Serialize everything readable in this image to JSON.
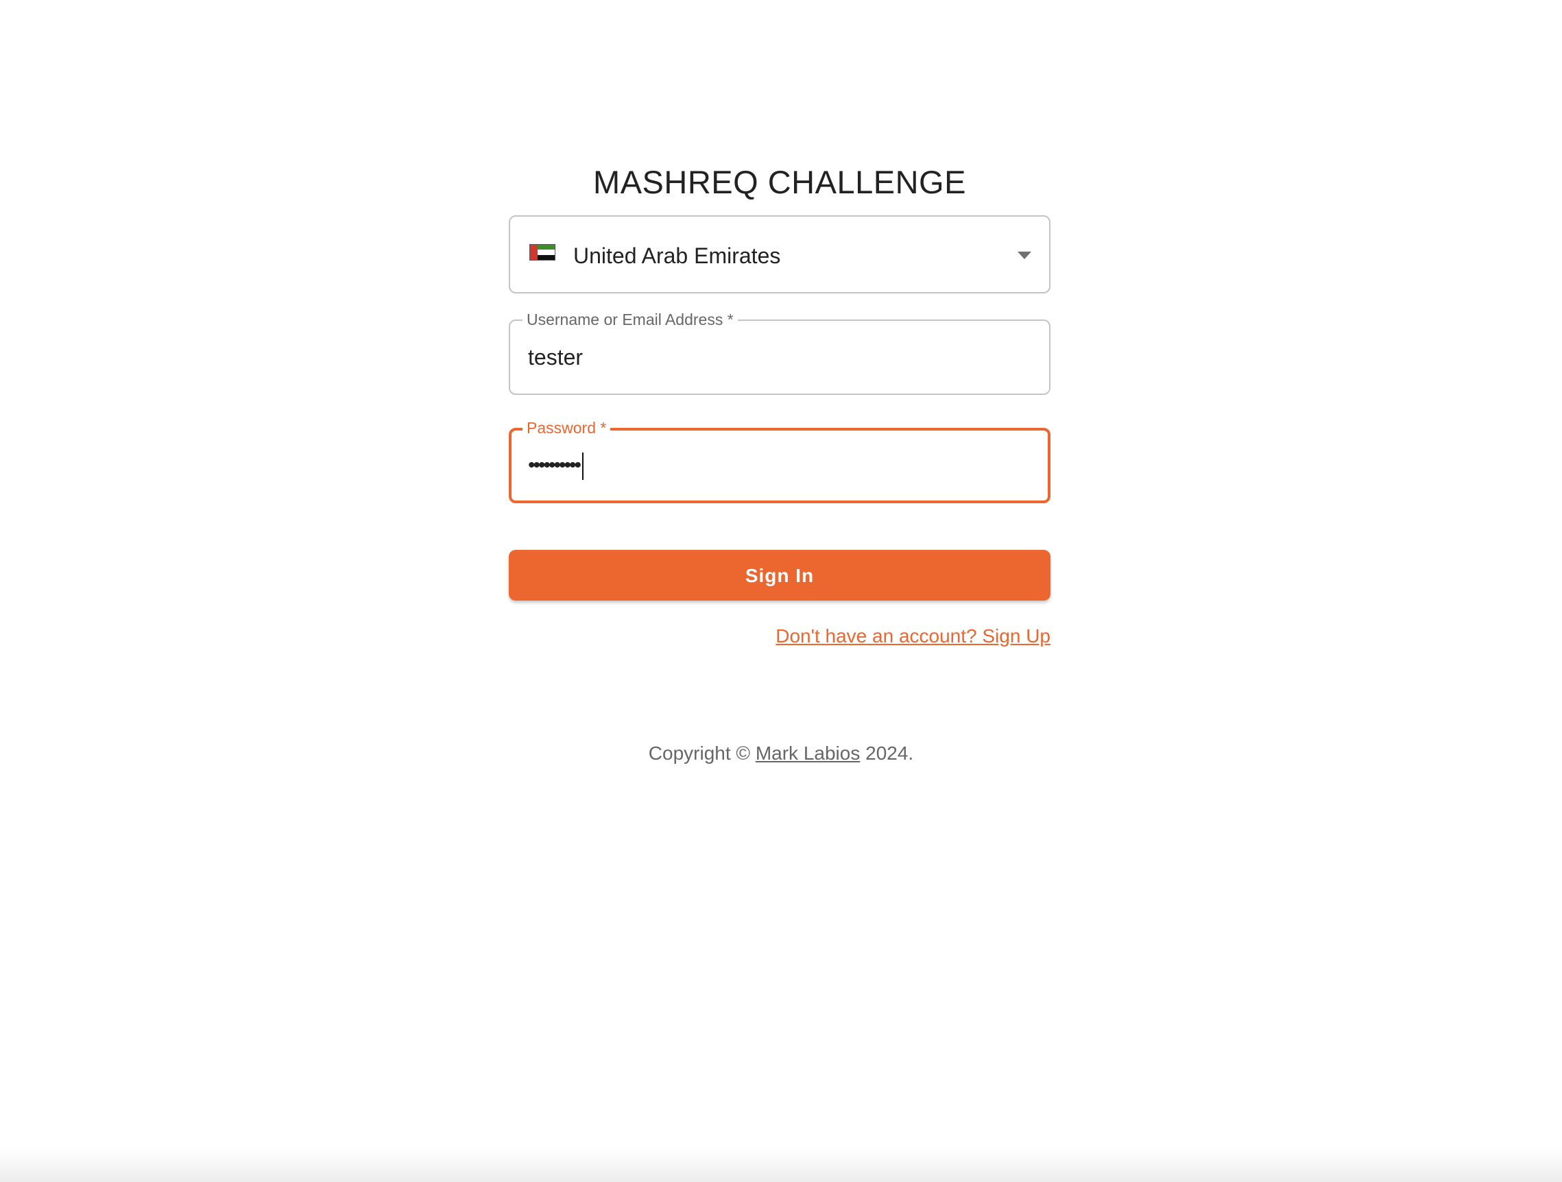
{
  "app": {
    "title": "MASHREQ CHALLENGE"
  },
  "country_select": {
    "selected": "United Arab Emirates",
    "flag_icon": "uae-flag-icon",
    "caret_icon": "caret-down-icon"
  },
  "username_field": {
    "label": "Username or Email Address *",
    "value": "tester"
  },
  "password_field": {
    "label": "Password *",
    "value": "••••••••••"
  },
  "signin_button": {
    "label": "Sign In"
  },
  "signup_link": {
    "label": "Don't have an account? Sign Up"
  },
  "footer": {
    "prefix": "Copyright © ",
    "author": "Mark Labios",
    "suffix": " 2024."
  },
  "colors": {
    "accent": "#ec6730",
    "border": "#c4c4c4",
    "text": "#222222",
    "muted": "#666666"
  }
}
